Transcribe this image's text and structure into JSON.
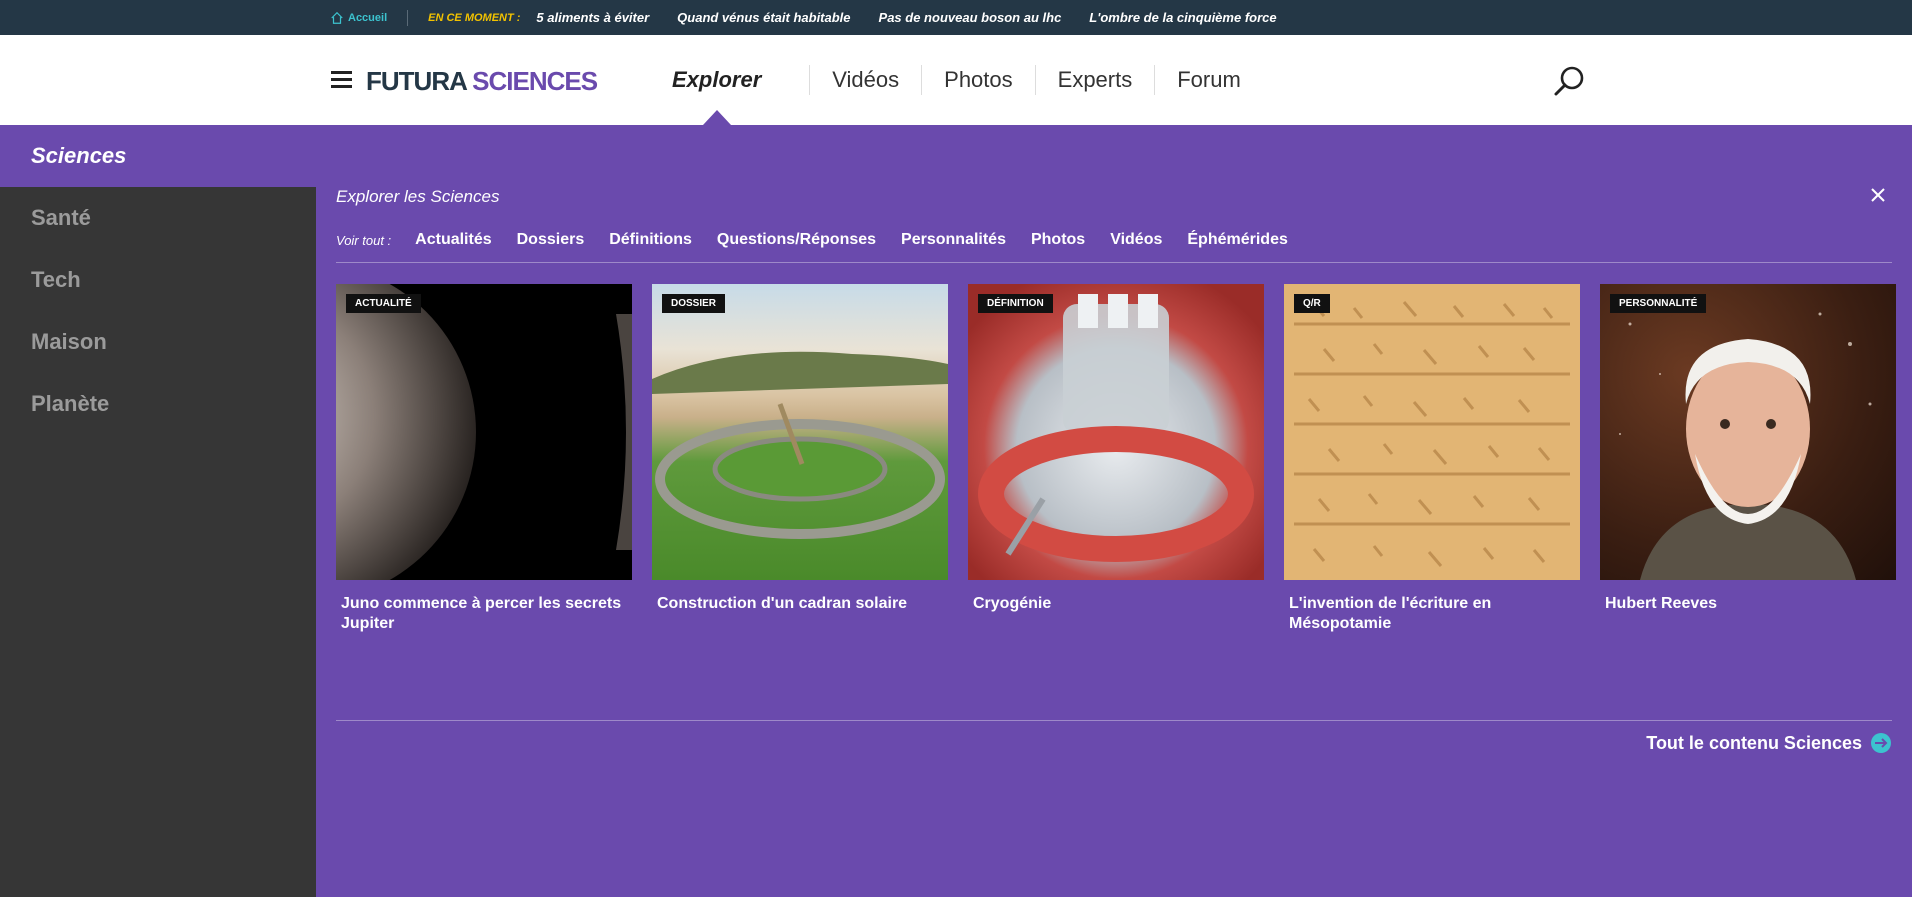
{
  "topbar": {
    "home": "Accueil",
    "now_label": "EN CE MOMENT :",
    "trends": [
      "5 aliments à éviter",
      "Quand vénus était habitable",
      "Pas de nouveau boson au lhc",
      "L'ombre de la cinquième force"
    ]
  },
  "header": {
    "logo_part1": "FUTURA",
    "logo_part2": "SCIENCES",
    "nav": [
      "Explorer",
      "Vidéos",
      "Photos",
      "Experts",
      "Forum"
    ]
  },
  "sidebar": {
    "items": [
      "Sciences",
      "Santé",
      "Tech",
      "Maison",
      "Planète"
    ]
  },
  "panel": {
    "title": "Explorer les Sciences",
    "filter_label": "Voir tout :",
    "filters": [
      "Actualités",
      "Dossiers",
      "Définitions",
      "Questions/Réponses",
      "Personnalités",
      "Photos",
      "Vidéos",
      "Éphémérides"
    ],
    "cards": [
      {
        "badge": "Actualité",
        "title": "Juno commence à percer les secrets Jupiter"
      },
      {
        "badge": "Dossier",
        "title": "Construction d'un cadran solaire"
      },
      {
        "badge": "Définition",
        "title": "Cryogénie"
      },
      {
        "badge": "Q/R",
        "title": "L'invention de l'écriture en Mésopotamie"
      },
      {
        "badge": "Personnalité",
        "title": "Hubert Reeves"
      }
    ],
    "all_link": "Tout le contenu Sciences"
  },
  "colors": {
    "purple": "#6a4aad",
    "topbar": "#243746",
    "sidebar": "#363636",
    "accent_yellow": "#f2c200",
    "accent_cyan": "#3cc3cf"
  }
}
